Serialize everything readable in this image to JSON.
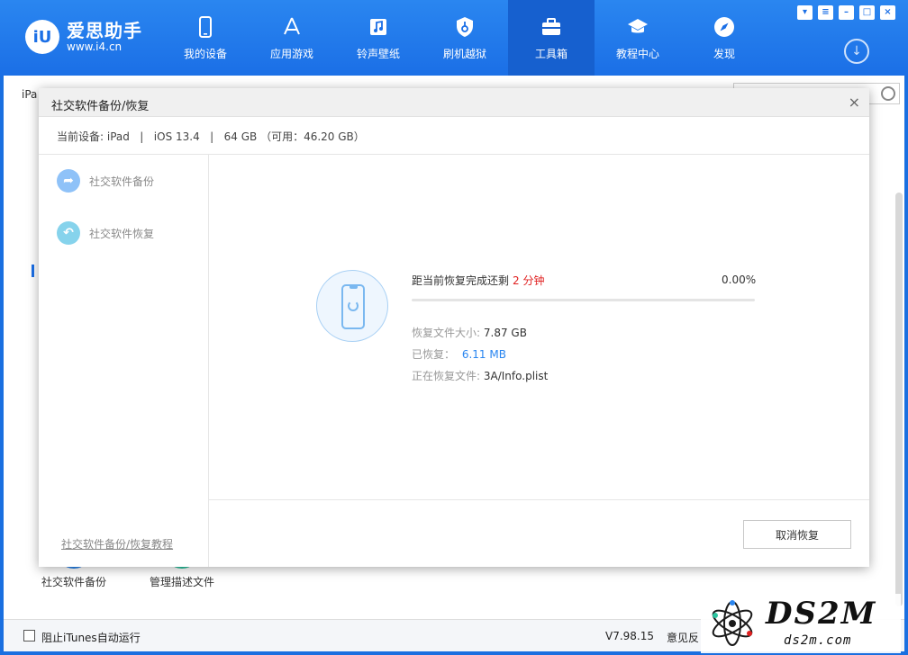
{
  "app": {
    "name": "爱思助手",
    "url": "www.i4.cn",
    "badge": "iU"
  },
  "nav": [
    {
      "label": "我的设备",
      "icon": "phone-icon"
    },
    {
      "label": "应用游戏",
      "icon": "appstore-icon"
    },
    {
      "label": "铃声壁纸",
      "icon": "music-icon"
    },
    {
      "label": "刷机越狱",
      "icon": "shield-icon"
    },
    {
      "label": "工具箱",
      "icon": "toolbox-icon",
      "active": true
    },
    {
      "label": "教程中心",
      "icon": "graduation-cap-icon"
    },
    {
      "label": "发现",
      "icon": "compass-icon"
    }
  ],
  "background": {
    "tab_label": "iPa",
    "tools": [
      {
        "label": "社交软件备份"
      },
      {
        "label": "管理描述文件"
      }
    ]
  },
  "status": {
    "itunes_label": "阻止iTunes自动运行",
    "version": "V7.98.15",
    "feedback": "意见反"
  },
  "watermark": {
    "big": "DS2M",
    "small": "ds2m.com"
  },
  "modal": {
    "title": "社交软件备份/恢复",
    "device_info": "当前设备: iPad   |   iOS 13.4   |   64 GB （可用：46.20 GB）",
    "menu": [
      {
        "label": "社交软件备份"
      },
      {
        "label": "社交软件恢复"
      }
    ],
    "tutorial_link": "社交软件备份/恢复教程",
    "progress": {
      "remain_label": "距当前恢复完成还剩",
      "remain_time": "2 分钟",
      "percent_text": "0.00%",
      "fraction": 0.0
    },
    "info": {
      "size_label": "恢复文件大小:",
      "size_value": "7.87 GB",
      "restored_label": "已恢复：",
      "restored_value": "6.11 MB",
      "current_label": "正在恢复文件:",
      "current_value": "3A/Info.plist"
    },
    "cancel_label": "取消恢复"
  },
  "colors": {
    "brand": "#1b6fe6",
    "accent": "#2a86f0",
    "alert": "#e02020"
  }
}
